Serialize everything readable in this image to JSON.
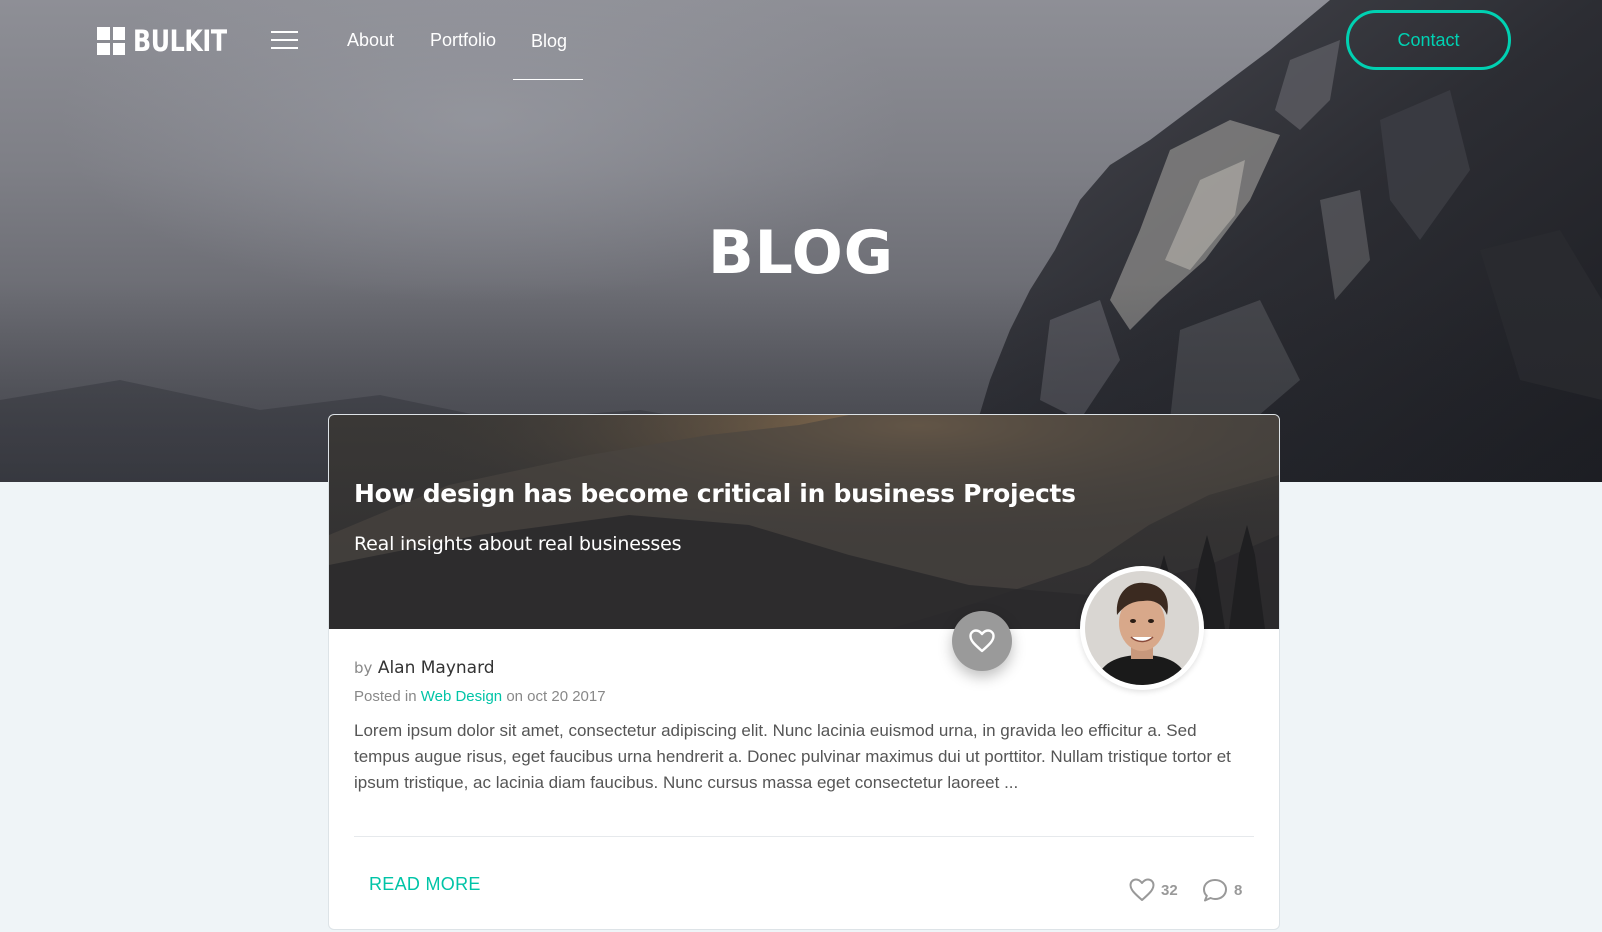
{
  "nav": {
    "logo_text": "BULKIT",
    "links": [
      "About",
      "Portfolio",
      "Blog"
    ],
    "active_link": "Blog",
    "contact_label": "Contact"
  },
  "hero": {
    "title": "BLOG"
  },
  "post": {
    "title": "How design has become critical in business Projects",
    "subtitle": "Real insights about real businesses",
    "by_prefix": "by",
    "author": "Alan Maynard",
    "posted_prefix": "Posted in",
    "category": "Web Design",
    "date_text": "on oct 20 2017",
    "excerpt": "Lorem ipsum dolor sit amet, consectetur adipiscing elit. Nunc lacinia euismod urna, in gravida leo efficitur a. Sed tempus augue risus, eget faucibus urna hendrerit a. Donec pulvinar maximus dui ut porttitor. Nullam tristique tortor et ipsum tristique, ac lacinia diam faucibus. Nunc cursus massa eget consectetur laoreet ...",
    "read_more_label": "READ MORE",
    "likes": "32",
    "comments": "8"
  },
  "colors": {
    "accent": "#00d1b2",
    "page_background": "#eff4f7",
    "fab": "#9a9a9a"
  },
  "icons": [
    "hamburger-icon",
    "heart-icon",
    "heart-outline-icon",
    "comment-icon"
  ]
}
